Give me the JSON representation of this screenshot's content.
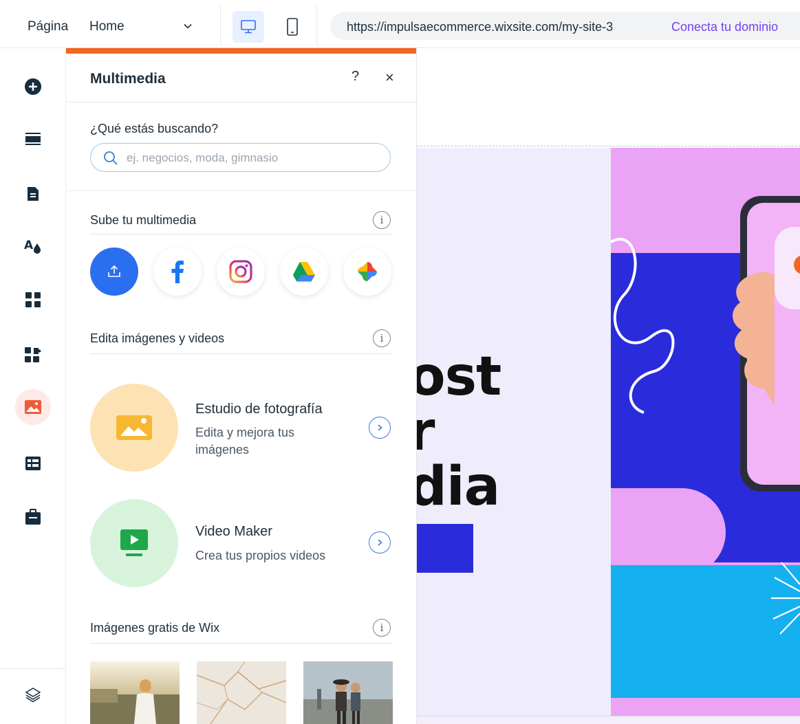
{
  "topbar": {
    "page_label": "Página",
    "page_selected": "Home",
    "url": "https://impulsaecommerce.wixsite.com/my-site-3",
    "connect_domain": "Conecta tu dominio"
  },
  "rail": {
    "items": [
      "add-icon",
      "sections-icon",
      "pages-icon",
      "design-icon",
      "apps-icon",
      "add-apps-icon",
      "media-icon",
      "cms-icon",
      "business-icon",
      "layers-icon"
    ],
    "active": "media-icon"
  },
  "panel": {
    "title": "Multimedia",
    "help": "?",
    "close": "×",
    "search_label": "¿Qué estás buscando?",
    "search_placeholder": "ej. negocios, moda, gimnasio",
    "upload_section": "Sube tu multimedia",
    "sources": [
      "upload",
      "facebook",
      "instagram",
      "google-drive",
      "google-photos"
    ],
    "edit_section": "Edita imágenes y videos",
    "photo_studio_title": "Estudio de fotografía",
    "photo_studio_desc": "Edita y mejora tus imágenes",
    "video_maker_title": "Video Maker",
    "video_maker_desc": "Crea tus propios videos",
    "free_images_section": "Imágenes gratis de Wix",
    "info_glyph": "i"
  },
  "canvas": {
    "hero_line1": "ost",
    "hero_line2": "r",
    "hero_line3": "dia"
  },
  "colors": {
    "accent": "#f26522",
    "primary_blue": "#2a6ff0",
    "link_purple": "#7a3ff2",
    "canvas_pink": "#eaa3f5",
    "canvas_blue": "#2a2cdb",
    "canvas_cyan": "#15b0f0"
  }
}
